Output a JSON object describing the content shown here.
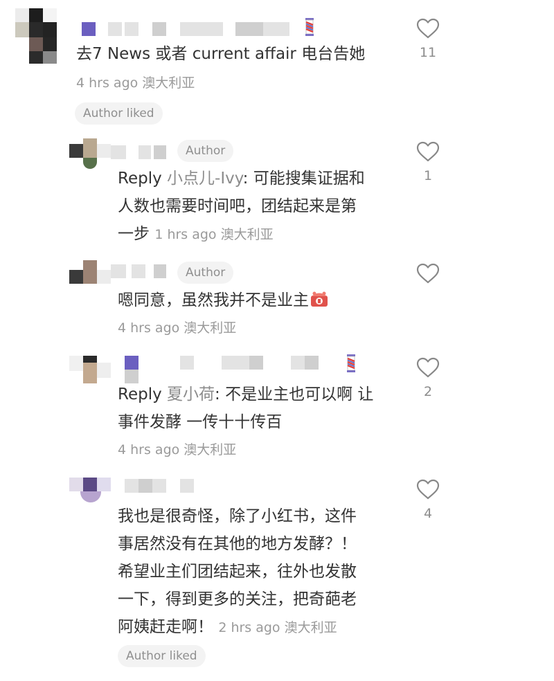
{
  "comments": [
    {
      "text": "去7 News 或者 current affair 电台告她",
      "meta": "4 hrs ago 澳大利亚",
      "author_liked": "Author liked",
      "likes": "11"
    },
    {
      "author_tag": "Author",
      "reply_label": "Reply",
      "reply_target": "小点儿-Ivy",
      "line1": ": 可能搜集证据和",
      "line2": "人数也需要时间吧，团结起来是第",
      "line3": "一步",
      "meta": "1 hrs ago 澳大利亚",
      "likes": "1"
    },
    {
      "author_tag": "Author",
      "text": "嗯同意，虽然我并不是业主",
      "meta": "4 hrs ago 澳大利亚",
      "likes": ""
    },
    {
      "reply_label": "Reply",
      "reply_target": "夏小荷",
      "line1": ": 不是业主也可以啊 让",
      "line2": "事件发酵 一传十十传百",
      "meta": "4 hrs ago 澳大利亚",
      "likes": "2"
    },
    {
      "line1": "我也是很奇怪，除了小红书，这件",
      "line2": "事居然没有在其他的地方发酵？！",
      "line3": "希望业主们团结起来，往外也发散",
      "line4": "一下，得到更多的关注，把奇葩老",
      "line5": "阿姨赶走啊！",
      "meta": "2 hrs ago 澳大利亚",
      "author_liked": "Author liked",
      "likes": "4"
    }
  ],
  "icons": {
    "like": "heart-outline-icon",
    "badge": "barber-pole-badge-icon",
    "emoji": "red-envelope-emoji-icon"
  },
  "colors": {
    "text": "#333333",
    "muted": "#9a9a9a",
    "pill_bg": "#f3f3f3",
    "heart": "#888888"
  }
}
